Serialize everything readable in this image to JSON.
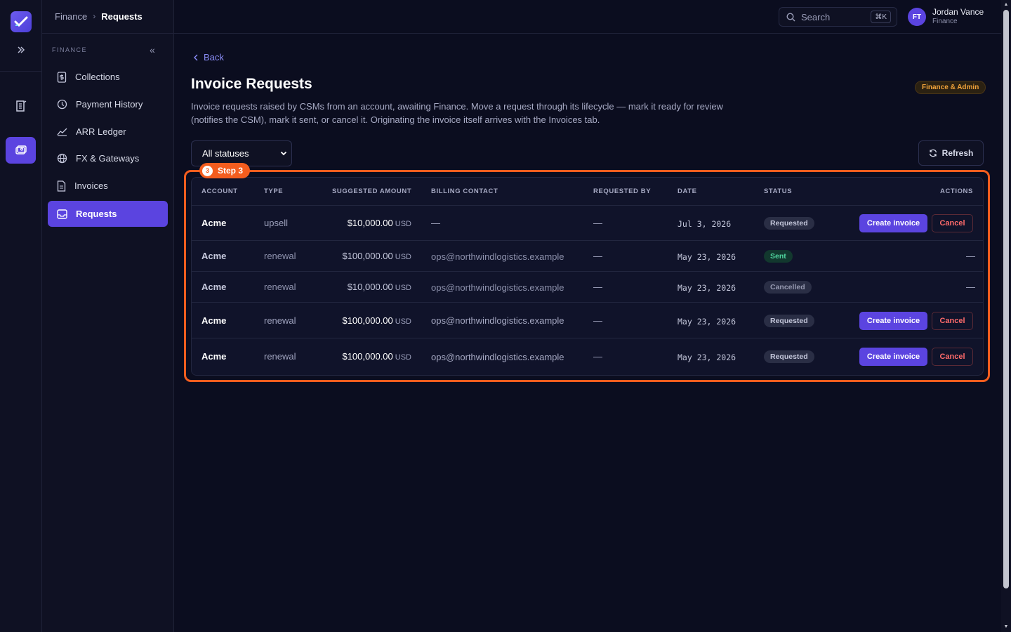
{
  "breadcrumb": {
    "parent": "Finance",
    "current": "Requests"
  },
  "search": {
    "placeholder": "Search",
    "shortcut": "⌘K"
  },
  "user": {
    "initials": "FT",
    "name": "Jordan Vance",
    "role": "Finance"
  },
  "sidebar": {
    "section": "FINANCE",
    "items": [
      {
        "label": "Collections",
        "icon": "dollar-doc-icon"
      },
      {
        "label": "Payment History",
        "icon": "history-icon"
      },
      {
        "label": "ARR Ledger",
        "icon": "chart-line-icon"
      },
      {
        "label": "FX & Gateways",
        "icon": "globe-icon"
      },
      {
        "label": "Invoices",
        "icon": "document-icon"
      },
      {
        "label": "Requests",
        "icon": "inbox-icon",
        "active": true
      }
    ]
  },
  "page": {
    "back": "Back",
    "title": "Invoice Requests",
    "description": "Invoice requests raised by CSMs from an account, awaiting Finance. Move a request through its lifecycle — mark it ready for review (notifies the CSM), mark it sent, or cancel it. Originating the invoice itself arrives with the Invoices tab.",
    "role_badge": "Finance & Admin",
    "filter": "All statuses",
    "refresh": "Refresh"
  },
  "step": {
    "number": "3",
    "label": "Step 3"
  },
  "table": {
    "headers": [
      "ACCOUNT",
      "TYPE",
      "SUGGESTED AMOUNT",
      "BILLING CONTACT",
      "REQUESTED BY",
      "DATE",
      "STATUS",
      "ACTIONS"
    ],
    "rows": [
      {
        "account": "Acme",
        "type": "upsell",
        "amount": "$10,000.00",
        "currency": "USD",
        "contact": "—",
        "requested_by": "—",
        "date": "Jul 3, 2026",
        "status": "Requested",
        "actions": true
      },
      {
        "account": "Acme",
        "type": "renewal",
        "amount": "$100,000.00",
        "currency": "USD",
        "contact": "ops@northwindlogistics.example",
        "requested_by": "—",
        "date": "May 23, 2026",
        "status": "Sent",
        "actions": false,
        "actions_text": "—"
      },
      {
        "account": "Acme",
        "type": "renewal",
        "amount": "$10,000.00",
        "currency": "USD",
        "contact": "ops@northwindlogistics.example",
        "requested_by": "—",
        "date": "May 23, 2026",
        "status": "Cancelled",
        "actions": false,
        "actions_text": "—"
      },
      {
        "account": "Acme",
        "type": "renewal",
        "amount": "$100,000.00",
        "currency": "USD",
        "contact": "ops@northwindlogistics.example",
        "requested_by": "—",
        "date": "May 23, 2026",
        "status": "Requested",
        "actions": true
      },
      {
        "account": "Acme",
        "type": "renewal",
        "amount": "$100,000.00",
        "currency": "USD",
        "contact": "ops@northwindlogistics.example",
        "requested_by": "—",
        "date": "May 23, 2026",
        "status": "Requested",
        "actions": true
      }
    ],
    "create_label": "Create invoice",
    "cancel_label": "Cancel"
  },
  "colors": {
    "accent": "#5b44e0",
    "highlight": "#f45d1e",
    "danger": "#ff6b6b",
    "success": "#4fd49e",
    "badge": "#f2a33a"
  }
}
